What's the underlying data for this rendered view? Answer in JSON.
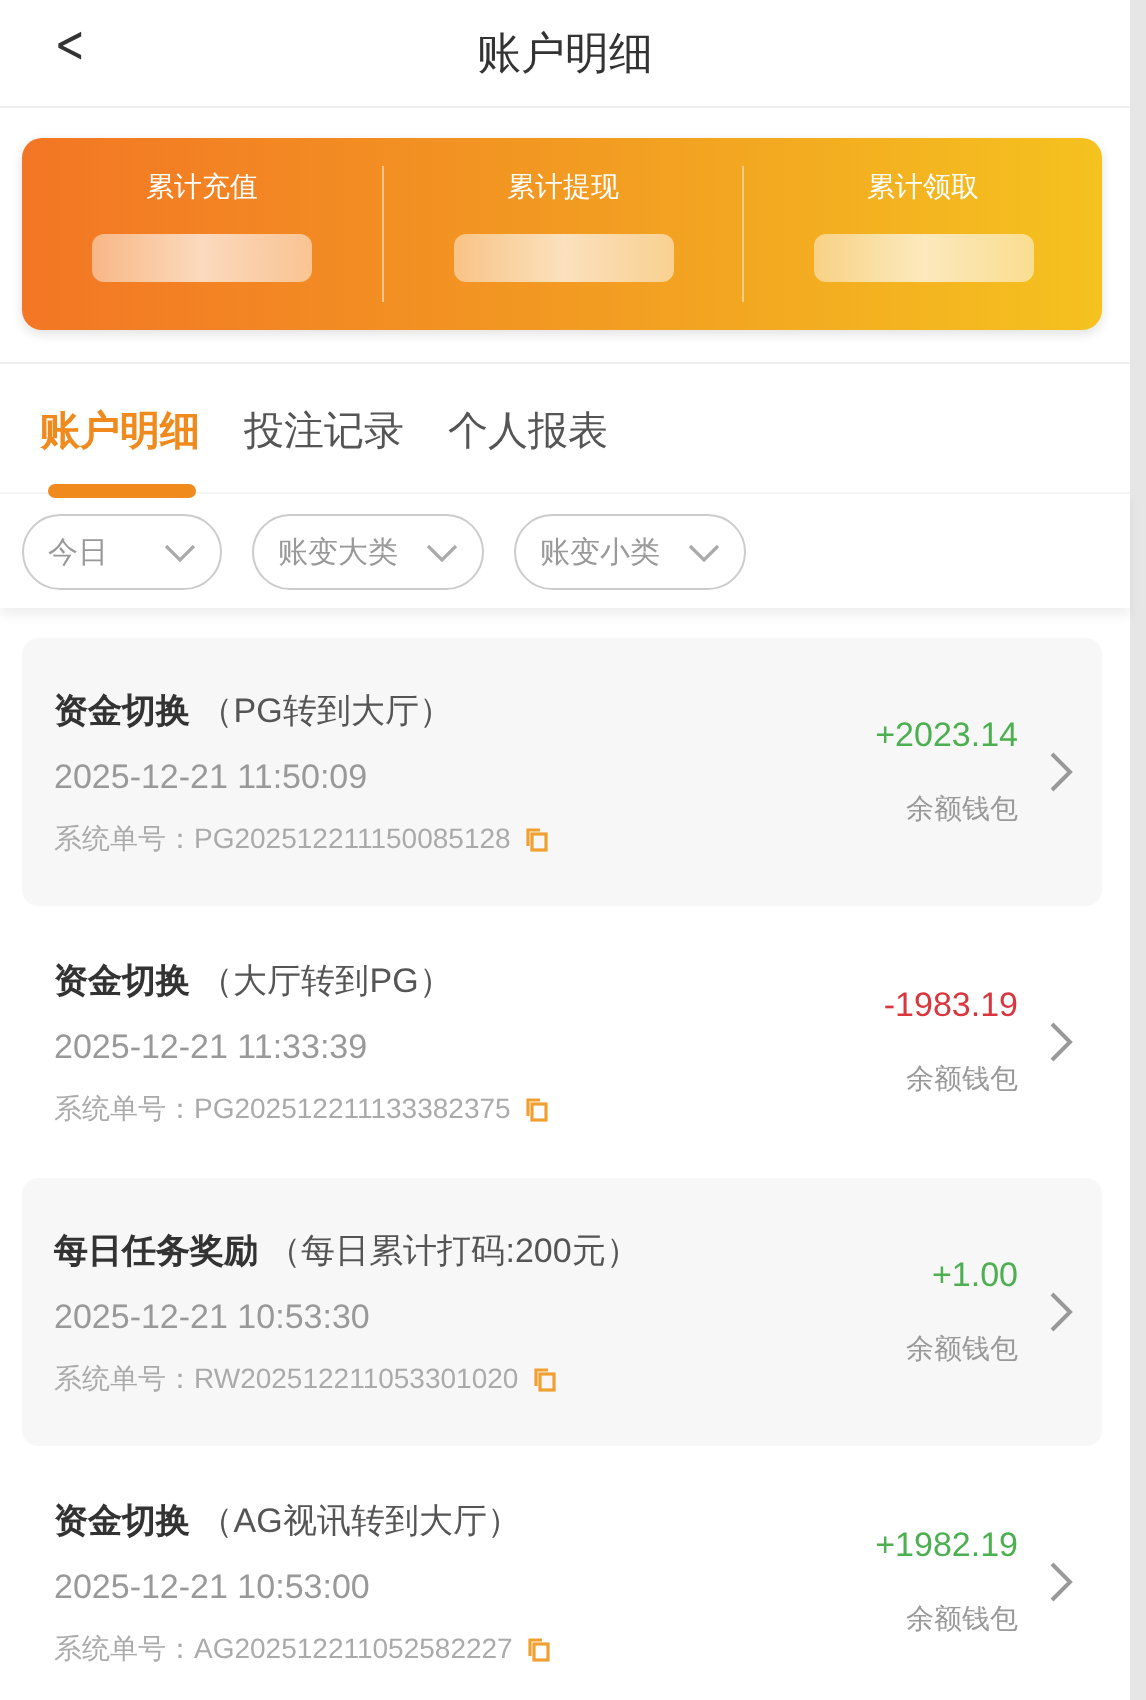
{
  "header": {
    "back": "<",
    "title": "账户明细"
  },
  "summary": [
    {
      "label": "累计充值"
    },
    {
      "label": "累计提现"
    },
    {
      "label": "累计领取"
    }
  ],
  "tabs": [
    {
      "label": "账户明细",
      "selected": true
    },
    {
      "label": "投注记录",
      "selected": false
    },
    {
      "label": "个人报表",
      "selected": false
    }
  ],
  "filters": [
    {
      "label": "今日"
    },
    {
      "label": "账变大类"
    },
    {
      "label": "账变小类"
    }
  ],
  "records": [
    {
      "title": "资金切换",
      "note": "（PG转到大厅）",
      "time": "2025-12-21 11:50:09",
      "order_label": "系统单号：",
      "order": "PG202512211150085128",
      "amount": "+2023.14",
      "color": "#4caf50",
      "wallet": "余额钱包"
    },
    {
      "title": "资金切换",
      "note": "（大厅转到PG）",
      "time": "2025-12-21 11:33:39",
      "order_label": "系统单号：",
      "order": "PG202512211133382375",
      "amount": "-1983.19",
      "color": "#d9363e",
      "wallet": "余额钱包"
    },
    {
      "title": "每日任务奖励",
      "note": "（每日累计打码:200元）",
      "time": "2025-12-21 10:53:30",
      "order_label": "系统单号：",
      "order": "RW202512211053301020",
      "amount": "+1.00",
      "color": "#4caf50",
      "wallet": "余额钱包"
    },
    {
      "title": "资金切换",
      "note": "（AG视讯转到大厅）",
      "time": "2025-12-21 10:53:00",
      "order_label": "系统单号：",
      "order": "AG202512211052582227",
      "amount": "+1982.19",
      "color": "#4caf50",
      "wallet": "余额钱包"
    }
  ]
}
